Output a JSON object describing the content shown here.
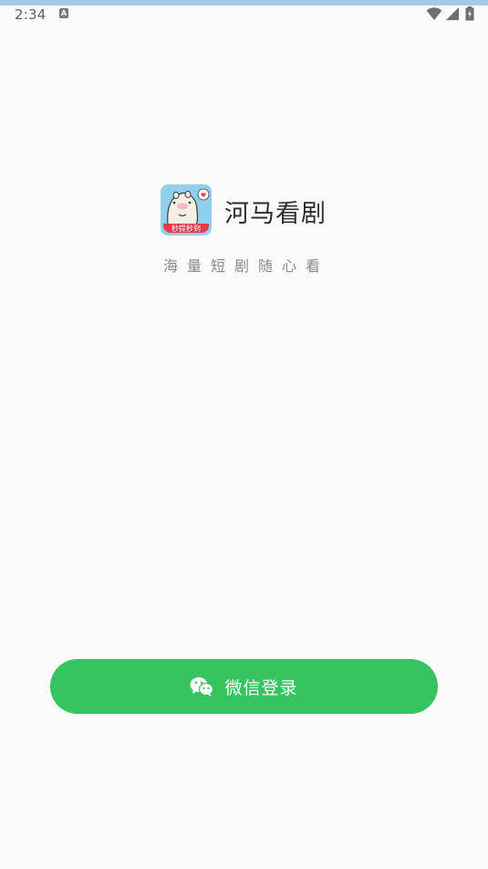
{
  "status_bar": {
    "time": "2:34",
    "notification_icon": "A",
    "icons": [
      "wifi-icon",
      "cell-signal-icon",
      "battery-charging-icon"
    ]
  },
  "brand": {
    "app_icon_badge": "秒提秒到",
    "app_name": "河马看剧",
    "tagline": "海量短剧随心看"
  },
  "login": {
    "wechat_label": "微信登录",
    "icon": "wechat-icon"
  },
  "colors": {
    "background": "#fafafa",
    "accent_green": "#35c45f",
    "icon_bg": "#8fd0ef",
    "badge_red": "#e5394c"
  }
}
